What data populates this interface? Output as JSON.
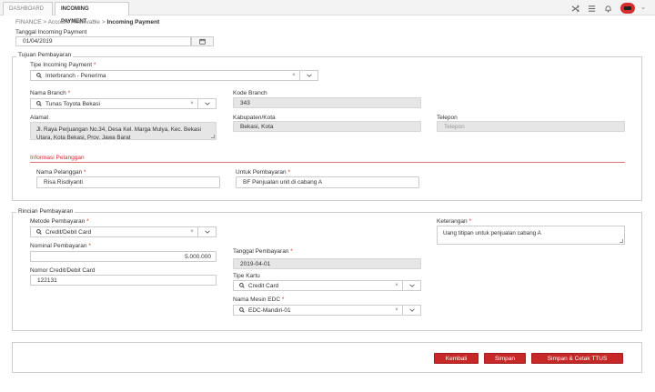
{
  "tabs": {
    "dashboard": "DASHBOARD",
    "incoming": "INCOMING PAYMENT",
    "close": "×"
  },
  "breadcrumb": {
    "finance": "FINANCE",
    "sep": ">",
    "receivable": "Account Receivable",
    "current": "Incoming Payment"
  },
  "header_fields": {
    "tanggal_label": "Tanggal Incoming Payment",
    "tanggal_value": "01/04/2019"
  },
  "tujuan": {
    "title": "Tujuan Pembayaran",
    "tipe_label": "Tipe Incoming Payment",
    "tipe_value": "Interbranch - Penerima",
    "branch_label": "Nama Branch",
    "branch_value": "Tunas Toyota Bekasi",
    "kode_label": "Kode Branch",
    "kode_value": "343",
    "alamat_label": "Alamat",
    "alamat_value": "Jl. Raya Perjuangan No.34, Desa Kel. Marga Mulya, Kec. Bekasi Utara, Kota Bekasi, Prov. Jawa Barat",
    "kab_label": "Kabupaten/Kota",
    "kab_value": "Bekasi, Kota",
    "telp_label": "Telepon",
    "telp_placeholder": "Telepon",
    "info_title": "Informasi Pelanggan",
    "pelanggan_label": "Nama Pelanggan",
    "pelanggan_value": "Risa Risdiyanti",
    "untuk_label": "Untuk Pembayaran",
    "untuk_value": "BF Penjualan unit di cabang A"
  },
  "rincian": {
    "title": "Rincian Pembayaran",
    "metode_label": "Metode Pembayaran",
    "metode_value": "Credit/Debit Card",
    "nominal_label": "Nominal Pembayaran",
    "nominal_value": "5.000.000",
    "tgl_label": "Tanggal Pembayaran",
    "tgl_value": "2019-04-01",
    "nomor_label": "Nomor Credit/Debit Card",
    "nomor_value": "122131",
    "tipe_kartu_label": "Tipe Kartu",
    "tipe_kartu_value": "Credit Card",
    "mesin_label": "Nama Mesin EDC",
    "mesin_value": "EDC-Mandiri-01",
    "ket_label": "Keterangan",
    "ket_value": "Uang titipan untuk penjualan cabang A"
  },
  "required_mark": "*",
  "clear_mark": "×",
  "buttons": {
    "kembali": "Kembali",
    "simpan": "Simpan",
    "simpan_cetak": "Simpan & Cetak TTUS"
  },
  "colors": {
    "accent": "#c62828",
    "readonly_bg": "#e6e6e6"
  }
}
